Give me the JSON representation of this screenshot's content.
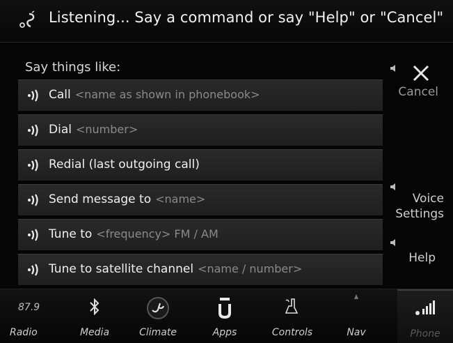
{
  "header": {
    "status_text": "Listening... Say a command or say \"Help\" or \"Cancel\""
  },
  "prompt": {
    "label": "Say things like:"
  },
  "commands": [
    {
      "main": "Call",
      "param": "<name as shown in phonebook>"
    },
    {
      "main": "Dial",
      "param": "<number>"
    },
    {
      "main": "Redial (last outgoing call)",
      "param": ""
    },
    {
      "main": "Send message to",
      "param": "<name>"
    },
    {
      "main": "Tune to",
      "param": "<frequency> FM / AM"
    },
    {
      "main": "Tune to satellite channel",
      "param": "<name / number>"
    }
  ],
  "side": {
    "cancel_label": "Cancel",
    "voice_label_1": "Voice",
    "voice_label_2": "Settings",
    "help_label": "Help"
  },
  "bottom": {
    "radio_freq": "87.9",
    "tabs": [
      {
        "label": "Radio",
        "icon": "radio-icon"
      },
      {
        "label": "Media",
        "icon": "bluetooth-icon"
      },
      {
        "label": "Climate",
        "icon": "climate-icon"
      },
      {
        "label": "Apps",
        "icon": "apps-icon"
      },
      {
        "label": "Controls",
        "icon": "controls-icon"
      },
      {
        "label": "Nav",
        "icon": "nav-icon"
      },
      {
        "label": "Phone",
        "icon": "phone-signal-icon"
      }
    ]
  },
  "colors": {
    "background": "#050505",
    "row": "#252525",
    "text": "#f0f0f0",
    "param_text": "#8a8a8a"
  }
}
